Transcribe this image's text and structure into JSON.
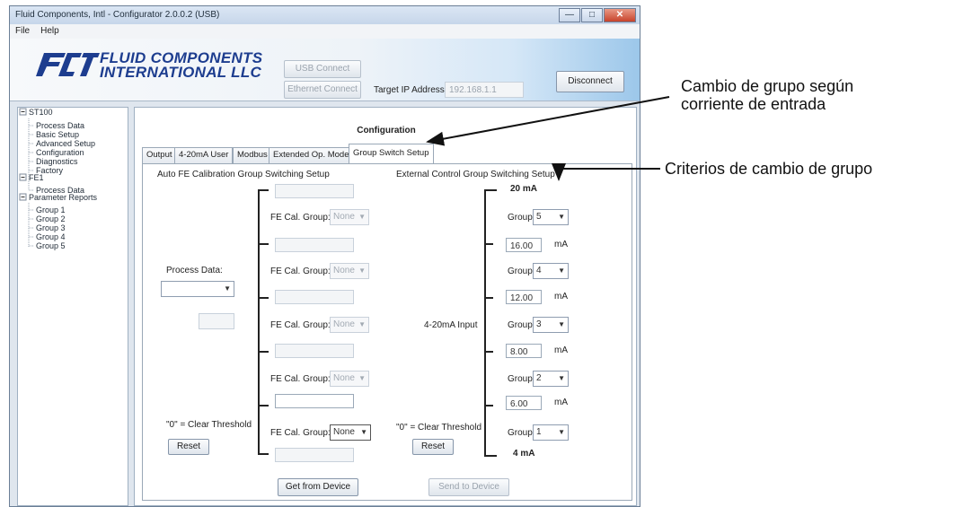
{
  "window": {
    "title": "Fluid Components, Intl - Configurator 2.0.0.2 (USB)",
    "controls": {
      "minimize": "—",
      "maximize": "□",
      "close": "✕"
    }
  },
  "menu": {
    "file": "File",
    "help": "Help"
  },
  "header": {
    "logo_line1": "FLUID COMPONENTS",
    "logo_line2": "INTERNATIONAL LLC",
    "usb_connect": "USB Connect",
    "ethernet_connect": "Ethernet Connect",
    "target_ip_label": "Target IP Address:",
    "target_ip_value": "192.168.1.1",
    "disconnect": "Disconnect"
  },
  "tree": {
    "st100": "ST100",
    "st100_items": [
      "Process Data",
      "Basic Setup",
      "Advanced Setup",
      "Configuration",
      "Diagnostics",
      "Factory"
    ],
    "fe1": "FE1",
    "fe1_items": [
      "Process Data"
    ],
    "reports": "Parameter Reports",
    "report_items": [
      "Group 1",
      "Group 2",
      "Group 3",
      "Group 4",
      "Group 5"
    ]
  },
  "main": {
    "title": "Configuration",
    "tabs": [
      "Output",
      "4-20mA User",
      "Modbus",
      "Extended Op. Mode",
      "Group Switch Setup"
    ],
    "left": {
      "heading": "Auto FE Calibration Group Switching Setup",
      "fe_cal_label": "FE Cal. Group:",
      "fe_cal_values": [
        "None",
        "None",
        "None",
        "None",
        "None"
      ],
      "process_data_label": "Process Data:",
      "clear_threshold": "\"0\" = Clear Threshold",
      "reset": "Reset"
    },
    "right": {
      "heading": "External Control Group Switching Setup",
      "top_label": "20 mA",
      "bottom_label": "4 mA",
      "input_label": "4-20mA Input",
      "group_label": "Group:",
      "groups": [
        "5",
        "4",
        "3",
        "2",
        "1"
      ],
      "thresholds": [
        "16.00",
        "12.00",
        "8.00",
        "6.00"
      ],
      "unit": "mA",
      "clear_threshold": "\"0\" = Clear Threshold",
      "reset": "Reset"
    },
    "get_from_device": "Get from Device",
    "send_to_device": "Send to Device"
  },
  "annotations": {
    "a1_line1": "Cambio de grupo según",
    "a1_line2": "corriente de entrada",
    "a2": "Criterios de cambio de grupo"
  }
}
